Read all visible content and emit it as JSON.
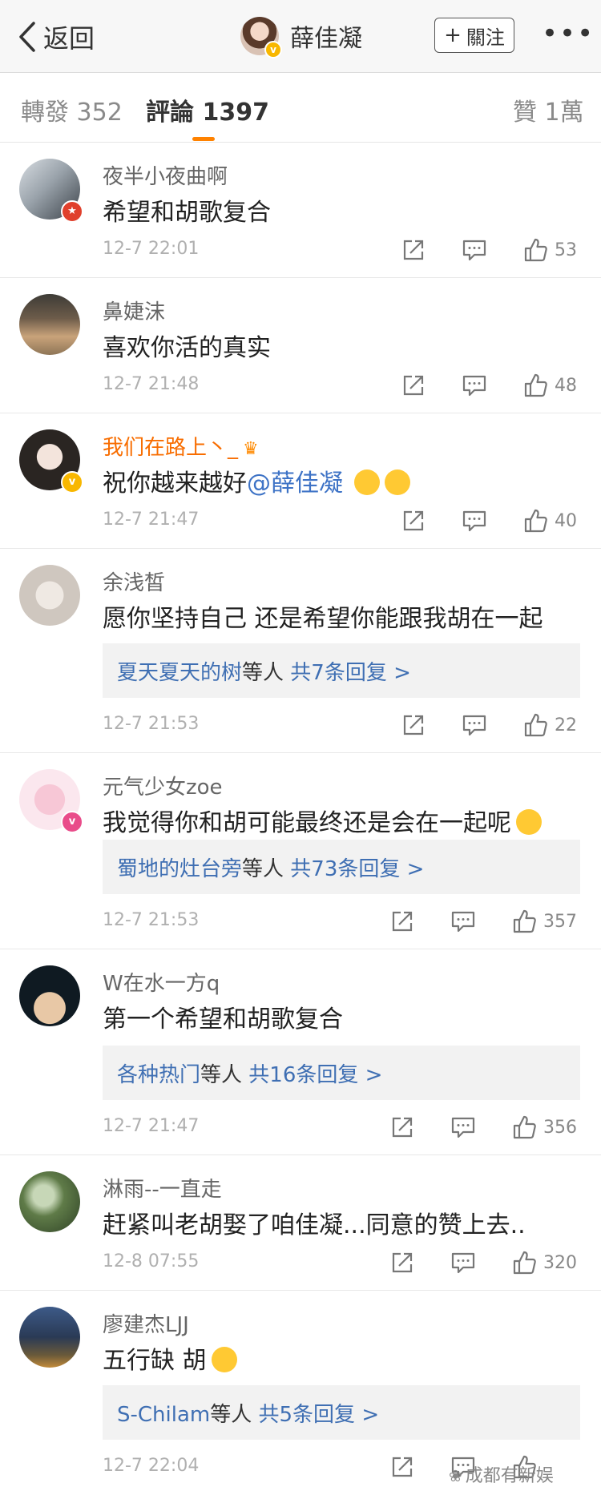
{
  "header": {
    "back_label": "返回",
    "profile_name": "薛佳凝",
    "follow_label": "關注",
    "more_label": "•••"
  },
  "tabs": {
    "repost": "轉發 352",
    "comments": "評論 1397",
    "likes": "贊 1萬"
  },
  "colors": {
    "accent": "#ff8200",
    "link": "#3f6fb3",
    "vip_name": "#f86d00"
  },
  "comments": [
    {
      "user": "夜半小夜曲啊",
      "text": "希望和胡歌复合",
      "time": "12-7 22:01",
      "likes": "53"
    },
    {
      "user": "鼻婕沫",
      "text": "喜欢你活的真实",
      "time": "12-7 21:48",
      "likes": "48"
    },
    {
      "user": "我们在路上丶_",
      "text_before": "祝你越来越好",
      "mention": "@薛佳凝",
      "time": "12-7 21:47",
      "likes": "40"
    },
    {
      "user": "余浅皙",
      "text": "愿你坚持自己 还是希望你能跟我胡在一起",
      "reply_names": "夏天夏天的树",
      "reply_suffix": "等人",
      "reply_count": "共7条回复 >",
      "time": "12-7 21:53",
      "likes": "22"
    },
    {
      "user": "元气少女zoe",
      "text": "我觉得你和胡可能最终还是会在一起呢",
      "reply_names": "蜀地的灶台旁",
      "reply_suffix": "等人",
      "reply_count": "共73条回复 >",
      "time": "12-7 21:53",
      "likes": "357"
    },
    {
      "user": "W在水一方q",
      "text": "第一个希望和胡歌复合",
      "reply_names": "各种热门",
      "reply_suffix": "等人",
      "reply_count": "共16条回复 >",
      "time": "12-7 21:47",
      "likes": "356"
    },
    {
      "user": "淋雨--一直走",
      "text": "赶紧叫老胡娶了咱佳凝...同意的赞上去..",
      "time": "12-8 07:55",
      "likes": "320"
    },
    {
      "user": "廖建杰LJJ",
      "text": "五行缺 胡",
      "reply_names": "S-Chilam",
      "reply_suffix": "等人",
      "reply_count": "共5条回复 >",
      "time": "12-7 22:04",
      "likes": ""
    }
  ],
  "watermark": "成都有新娱"
}
